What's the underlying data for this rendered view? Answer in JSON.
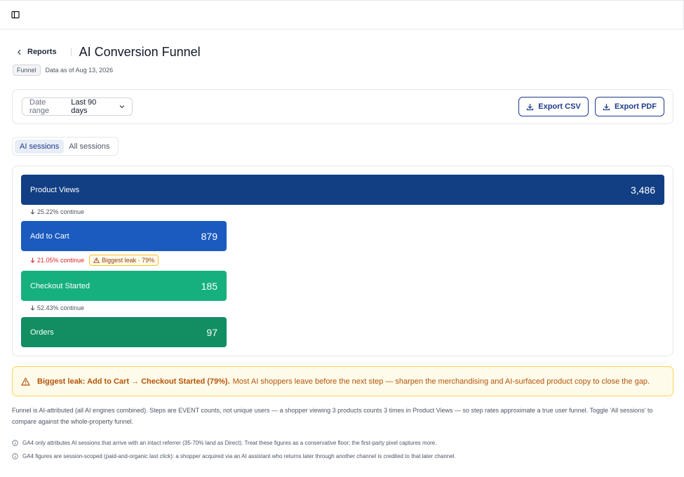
{
  "header": {
    "back_label": "Reports",
    "title": "AI Conversion Funnel",
    "badge": "Funnel",
    "data_as_of": "Data as of Aug 13, 2026"
  },
  "filters": {
    "date_range_label": "Date range",
    "date_range_value": "Last 90 days",
    "export_csv": "Export CSV",
    "export_pdf": "Export PDF"
  },
  "toggle": {
    "active": "AI sessions",
    "inactive": "All sessions"
  },
  "funnel": {
    "steps": [
      {
        "name": "Product Views",
        "count": "3,486",
        "value": 3486,
        "color": "#123f84"
      },
      {
        "name": "Add to Cart",
        "count": "879",
        "value": 879,
        "color": "#1b5bbf"
      },
      {
        "name": "Checkout Started",
        "count": "185",
        "value": 185,
        "color": "#16b07e"
      },
      {
        "name": "Orders",
        "count": "97",
        "value": 97,
        "color": "#118f62"
      }
    ],
    "transitions": [
      {
        "text": "25.22% continue"
      },
      {
        "text": "21.05% continue",
        "leak_badge": "Biggest leak · 79%"
      },
      {
        "text": "52.43% continue"
      }
    ]
  },
  "alert": {
    "strong": "Biggest leak: Add to Cart → Checkout Started (79%).",
    "text": "Most AI shoppers leave before the next step — sharpen the merchandising and AI-surfaced product copy to close the gap."
  },
  "notes": {
    "footnote": "Funnel is AI-attributed (all AI engines combined). Steps are EVENT counts, not unique users — a shopper viewing 3 products counts 3 times in Product Views — so step rates approximate a true user funnel. Toggle 'All sessions' to compare against the whole-property funnel.",
    "info_1": "GA4 only attributes AI sessions that arrive with an intact referrer (35-70% land as Direct). Treat these figures as a conservative floor; the first-party pixel captures more.",
    "info_2": "GA4 figures are session-scoped (paid-and-organic last click): a shopper acquired via an AI assistant who returns later through another channel is credited to that later channel."
  },
  "icons": {
    "sidebar_toggle": "sidebar-toggle-icon",
    "back": "chevron-left-icon",
    "dropdown": "chevron-down-icon",
    "download": "download-icon",
    "arrow_down": "arrow-down-icon",
    "warning": "warning-triangle-icon",
    "info": "info-circle-icon"
  }
}
